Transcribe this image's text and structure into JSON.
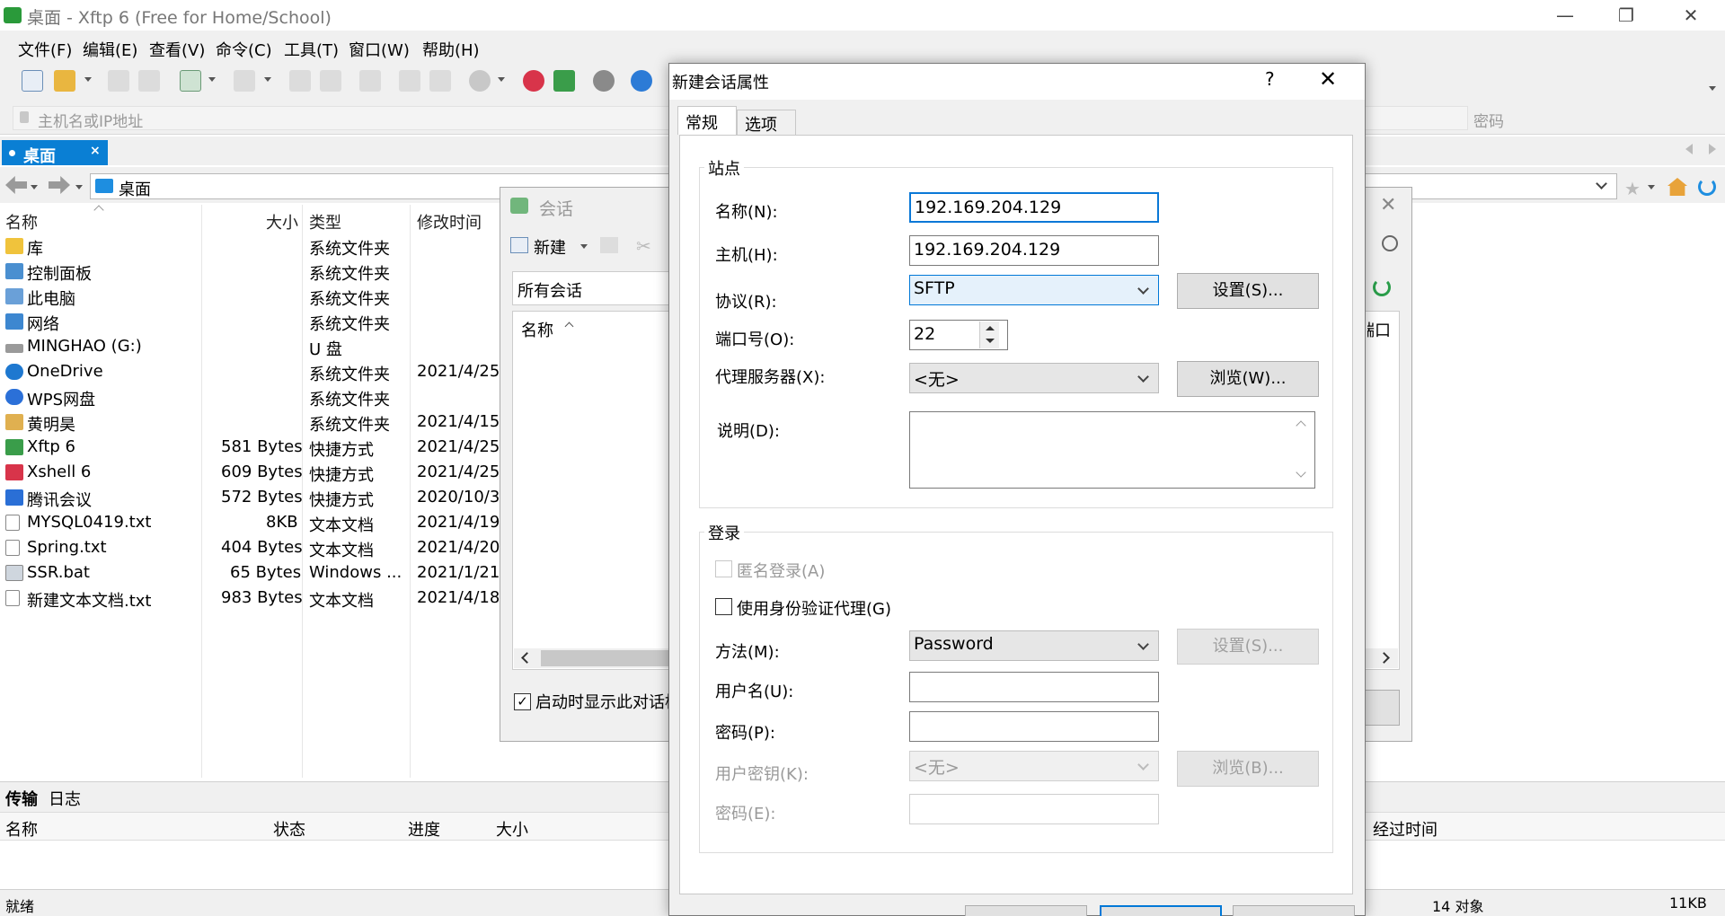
{
  "window": {
    "title": "桌面 - Xftp 6 (Free for Home/School)",
    "controls": {
      "minimize": "—",
      "restore": "❐",
      "close": "✕"
    }
  },
  "menu": [
    "文件(F)",
    "编辑(E)",
    "查看(V)",
    "命令(C)",
    "工具(T)",
    "窗口(W)",
    "帮助(H)"
  ],
  "address": {
    "host_placeholder": "主机名或IP地址",
    "password_placeholder": "密码"
  },
  "tabs": [
    {
      "label": "桌面",
      "close": "×"
    }
  ],
  "path": {
    "current": "桌面"
  },
  "file_list": {
    "columns": [
      "名称",
      "大小",
      "类型",
      "修改时间"
    ],
    "rows": [
      {
        "name": "库",
        "size": "",
        "type": "系统文件夹",
        "modified": ""
      },
      {
        "name": "控制面板",
        "size": "",
        "type": "系统文件夹",
        "modified": ""
      },
      {
        "name": "此电脑",
        "size": "",
        "type": "系统文件夹",
        "modified": ""
      },
      {
        "name": "网络",
        "size": "",
        "type": "系统文件夹",
        "modified": ""
      },
      {
        "name": "MINGHAO (G:)",
        "size": "",
        "type": "U 盘",
        "modified": ""
      },
      {
        "name": "OneDrive",
        "size": "",
        "type": "系统文件夹",
        "modified": "2021/4/25"
      },
      {
        "name": "WPS网盘",
        "size": "",
        "type": "系统文件夹",
        "modified": ""
      },
      {
        "name": "黄明昊",
        "size": "",
        "type": "系统文件夹",
        "modified": "2021/4/15"
      },
      {
        "name": "Xftp 6",
        "size": "581 Bytes",
        "type": "快捷方式",
        "modified": "2021/4/25"
      },
      {
        "name": "Xshell 6",
        "size": "609 Bytes",
        "type": "快捷方式",
        "modified": "2021/4/25"
      },
      {
        "name": "腾讯会议",
        "size": "572 Bytes",
        "type": "快捷方式",
        "modified": "2020/10/3"
      },
      {
        "name": "MYSQL0419.txt",
        "size": "8KB",
        "type": "文本文档",
        "modified": "2021/4/19"
      },
      {
        "name": "Spring.txt",
        "size": "404 Bytes",
        "type": "文本文档",
        "modified": "2021/4/20"
      },
      {
        "name": "SSR.bat",
        "size": "65 Bytes",
        "type": "Windows ...",
        "modified": "2021/1/21"
      },
      {
        "name": "新建文本文档.txt",
        "size": "983 Bytes",
        "type": "文本文档",
        "modified": "2021/4/18"
      }
    ]
  },
  "session_dialog": {
    "title": "会话",
    "new_label": "新建",
    "all_sessions": "所有会话",
    "name_col": "名称",
    "right_col": "端口",
    "show_on_startup": "启动时显示此对话框"
  },
  "transfer": {
    "tabs": [
      "传输",
      "日志"
    ],
    "columns": [
      "名称",
      "状态",
      "进度",
      "大小",
      "经过时间"
    ]
  },
  "status": {
    "left": "就绪",
    "count": "14 对象",
    "size": "11KB"
  },
  "prop_dialog": {
    "title": "新建会话属性",
    "help": "?",
    "close": "✕",
    "tabs": [
      "常规",
      "选项"
    ],
    "site_group": "站点",
    "name_label": "名称(N):",
    "name_value": "192.169.204.129",
    "host_label": "主机(H):",
    "host_value": "192.169.204.129",
    "protocol_label": "协议(R):",
    "protocol_value": "SFTP",
    "settings_btn": "设置(S)...",
    "port_label": "端口号(O):",
    "port_value": "22",
    "proxy_label": "代理服务器(X):",
    "proxy_value": "<无>",
    "browse_btn": "浏览(W)...",
    "desc_label": "说明(D):",
    "login_group": "登录",
    "anonymous_label": "匿名登录(A)",
    "agent_label": "使用身份验证代理(G)",
    "method_label": "方法(M):",
    "method_value": "Password",
    "method_settings_btn": "设置(S)...",
    "user_label": "用户名(U):",
    "password_label": "密码(P):",
    "userkey_label": "用户密钥(K):",
    "userkey_value": "<无>",
    "userkey_browse_btn": "浏览(B)...",
    "passphrase_label": "密码(E):"
  }
}
